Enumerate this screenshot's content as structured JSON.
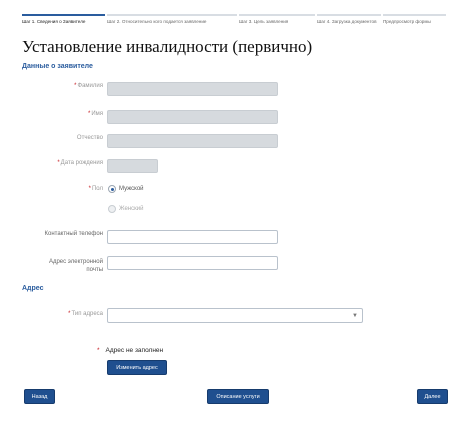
{
  "steps": [
    {
      "label": "Шаг 1. Сведения о Заявителе"
    },
    {
      "label": "Шаг 2. Относительно кого подается заявление"
    },
    {
      "label": "Шаг 3. Цель заявления"
    },
    {
      "label": "Шаг 4. Загрузка документов"
    },
    {
      "label": "Предпросмотр формы"
    }
  ],
  "page_title": "Установление инвалидности (первично)",
  "applicant": {
    "section_title": "Данные о заявителе",
    "req_mark": "*",
    "surname_label": "Фамилия",
    "name_label": "Имя",
    "patronymic_label": "Отчество",
    "birthdate_label": "Дата рождения",
    "gender_label": "Пол",
    "gender_male": "Мужской",
    "gender_female": "Женский",
    "phone_label": "Контактный телефон",
    "email_label": "Адрес электронной почты"
  },
  "address": {
    "section_title": "Адрес",
    "type_label": "Тип адреса",
    "caret": "▼",
    "error_mark": "*",
    "error_text": "Адрес не заполнен",
    "change_button": "Изменить адрес"
  },
  "footer": {
    "back_button": "Назад",
    "service_button": "Описание услуги",
    "next_button": "Далее"
  }
}
